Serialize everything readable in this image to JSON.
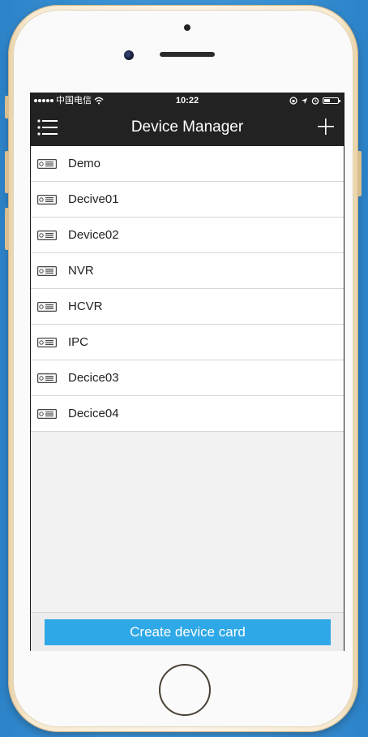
{
  "status_bar": {
    "carrier": "中国电信",
    "time": "10:22"
  },
  "nav": {
    "title": "Device Manager",
    "menu_icon": "list-menu-icon",
    "add_icon": "plus-icon"
  },
  "devices": [
    {
      "name": "Demo"
    },
    {
      "name": "Decive01"
    },
    {
      "name": "Device02"
    },
    {
      "name": "NVR"
    },
    {
      "name": "HCVR"
    },
    {
      "name": "IPC"
    },
    {
      "name": "Decice03"
    },
    {
      "name": "Decice04"
    }
  ],
  "device_icon": "dvr-device-icon",
  "footer": {
    "create_label": "Create device card"
  },
  "colors": {
    "nav_bg": "#222222",
    "button_bg": "#2fa8e8",
    "background": "#3a8fd0"
  }
}
